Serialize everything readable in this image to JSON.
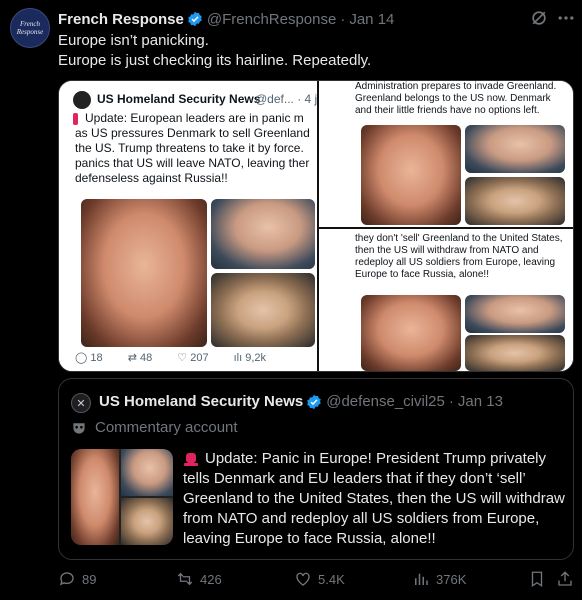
{
  "post": {
    "avatar_text": "French Response",
    "author_name": "French Response",
    "handle": "@FrenchResponse",
    "separator": "·",
    "date": "Jan 14",
    "line1": "Europe isn’t panicking.",
    "line2": "Europe is just checking its hairline. Repeatedly."
  },
  "media": {
    "left": {
      "author": "US Homeland Security News",
      "handle": "@def... · 4 j",
      "text": "Update: European leaders are in panic m as US pressures Denmark to sell Greenland the US. Trump threatens to take it by force. panics that US will leave NATO, leaving ther defenseless against Russia!!",
      "replies": "18",
      "reposts": "48",
      "likes": "207",
      "views": "9,2k"
    },
    "top_right_text": "Administration prepares to invade Greenland. Greenland belongs to the US now. Denmark and their little friends have no options left.",
    "bottom_right_text": "they don't 'sell' Greenland to the United States, then the US will withdraw from NATO and redeploy all US soldiers from Europe, leaving Europe to face Russia, alone!!"
  },
  "quote": {
    "author": "US Homeland Security News",
    "handle": "@defense_civil25",
    "separator": "·",
    "date": "Jan 13",
    "label": "Commentary account",
    "text": "Update: Panic in Europe! President Trump privately tells Denmark and EU leaders that if they don’t ‘sell’ Greenland to the United States, then the US will withdraw from NATO and redeploy all US soldiers from Europe, leaving Europe to face Russia, alone!!"
  },
  "actions": {
    "replies": "89",
    "reposts": "426",
    "likes": "5.4K",
    "views": "376K"
  },
  "colors": {
    "verified": "#1d9bf0",
    "alert": "#e0245e",
    "muted": "#71767b"
  },
  "icons": [
    "verified-badge-icon",
    "grok-icon",
    "more-icon",
    "alert-light-icon",
    "reply-icon",
    "repost-icon",
    "like-icon",
    "views-icon",
    "bookmark-icon",
    "share-icon"
  ]
}
